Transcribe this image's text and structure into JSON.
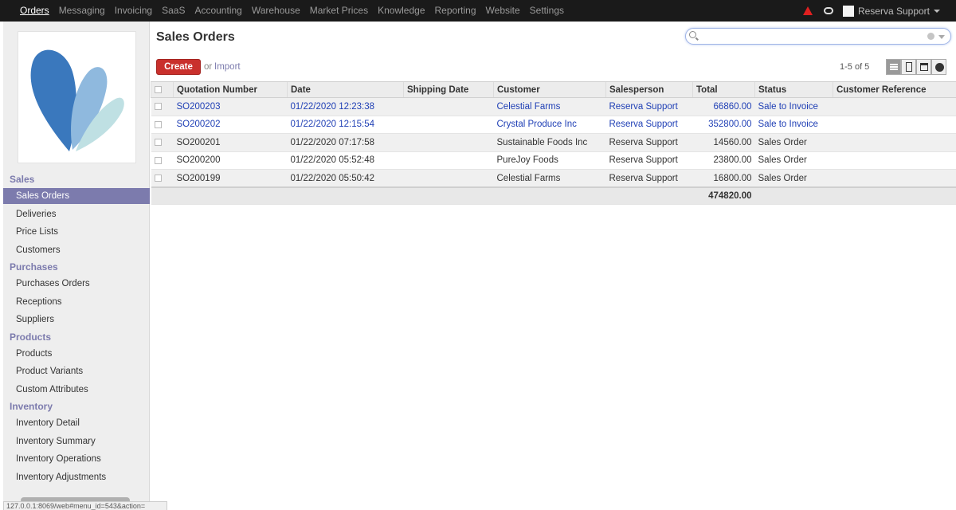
{
  "topnav": {
    "items": [
      "Orders",
      "Messaging",
      "Invoicing",
      "SaaS",
      "Accounting",
      "Warehouse",
      "Market Prices",
      "Knowledge",
      "Reporting",
      "Website",
      "Settings"
    ],
    "user": "Reserva Support"
  },
  "sidebar": {
    "sections": [
      {
        "title": "Sales",
        "items": [
          "Sales Orders",
          "Deliveries",
          "Price Lists",
          "Customers"
        ]
      },
      {
        "title": "Purchases",
        "items": [
          "Purchases Orders",
          "Receptions",
          "Suppliers"
        ]
      },
      {
        "title": "Products",
        "items": [
          "Products",
          "Product Variants",
          "Custom Attributes"
        ]
      },
      {
        "title": "Inventory",
        "items": [
          "Inventory Detail",
          "Inventory Summary",
          "Inventory Operations",
          "Inventory Adjustments"
        ]
      }
    ],
    "active": "Sales Orders"
  },
  "main": {
    "title": "Sales Orders",
    "create_label": "Create",
    "or_text": "or",
    "import_label": "Import",
    "pager": "1-5 of 5",
    "search_placeholder": ""
  },
  "table": {
    "columns": [
      "Quotation Number",
      "Date",
      "Shipping Date",
      "Customer",
      "Salesperson",
      "Total",
      "Status",
      "Customer Reference"
    ],
    "rows": [
      {
        "number": "SO200203",
        "date": "01/22/2020 12:23:38",
        "shipping": "",
        "customer": "Celestial Farms",
        "salesperson": "Reserva Support",
        "total": "66860.00",
        "status": "Sale to Invoice",
        "ref": "",
        "highlight": true
      },
      {
        "number": "SO200202",
        "date": "01/22/2020 12:15:54",
        "shipping": "",
        "customer": "Crystal Produce Inc",
        "salesperson": "Reserva Support",
        "total": "352800.00",
        "status": "Sale to Invoice",
        "ref": "",
        "highlight": true
      },
      {
        "number": "SO200201",
        "date": "01/22/2020 07:17:58",
        "shipping": "",
        "customer": "Sustainable Foods Inc",
        "salesperson": "Reserva Support",
        "total": "14560.00",
        "status": "Sales Order",
        "ref": "",
        "highlight": false
      },
      {
        "number": "SO200200",
        "date": "01/22/2020 05:52:48",
        "shipping": "",
        "customer": "PureJoy Foods",
        "salesperson": "Reserva Support",
        "total": "23800.00",
        "status": "Sales Order",
        "ref": "",
        "highlight": false
      },
      {
        "number": "SO200199",
        "date": "01/22/2020 05:50:42",
        "shipping": "",
        "customer": "Celestial Farms",
        "salesperson": "Reserva Support",
        "total": "16800.00",
        "status": "Sales Order",
        "ref": "",
        "highlight": false
      }
    ],
    "grand_total": "474820.00"
  },
  "statusbar": {
    "url": "127.0.0.1:8069/web#menu_id=543&action="
  },
  "colors": {
    "accent": "#7c7bad",
    "create": "#c9302c",
    "link": "#1f3fb5",
    "topbar": "#1a1a1a"
  }
}
